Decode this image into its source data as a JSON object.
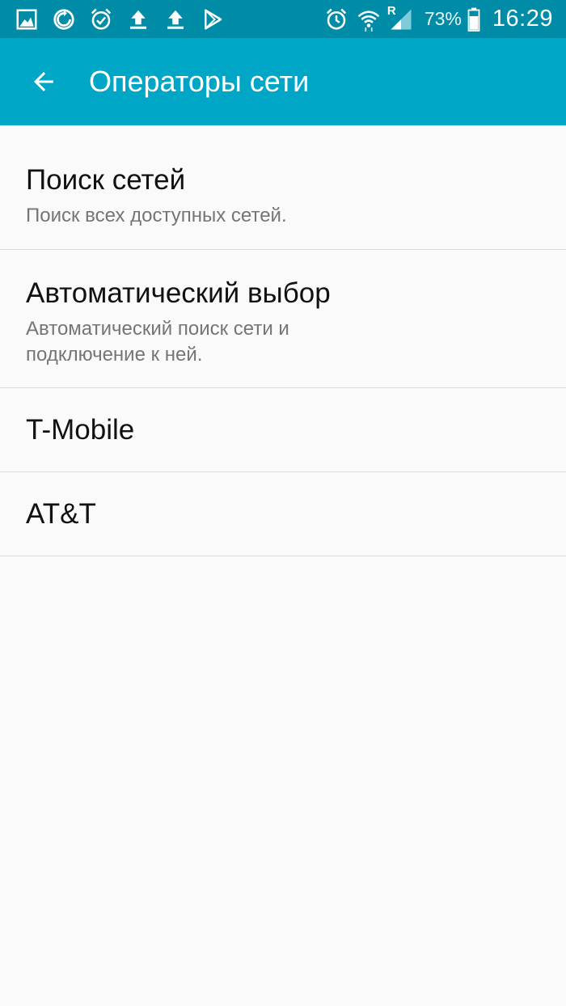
{
  "status_bar": {
    "left_icons": [
      "gallery-icon",
      "sync-icon",
      "alarm-icon",
      "upload-icon",
      "upload-icon",
      "play-store-icon"
    ],
    "right_icons": [
      "alarm-icon",
      "wifi-icon",
      "signal-roaming-icon"
    ],
    "roaming_label": "R",
    "battery_percent": "73%",
    "battery_level": 0.73,
    "time": "16:29"
  },
  "app_bar": {
    "back_icon": "arrow-left-icon",
    "title": "Операторы сети"
  },
  "items": [
    {
      "title": "Поиск сетей",
      "subtitle": "Поиск всех доступных сетей."
    },
    {
      "title": "Автоматический выбор",
      "subtitle": "Автоматический поиск сети и подключение к ней."
    },
    {
      "title": "T-Mobile"
    },
    {
      "title": "AT&T"
    }
  ],
  "colors": {
    "status_bar": "#008ca6",
    "app_bar": "#00a6c5",
    "background": "#fafafa",
    "divider": "#dcdcdc",
    "title_text": "#111111",
    "subtitle_text": "#757575"
  }
}
